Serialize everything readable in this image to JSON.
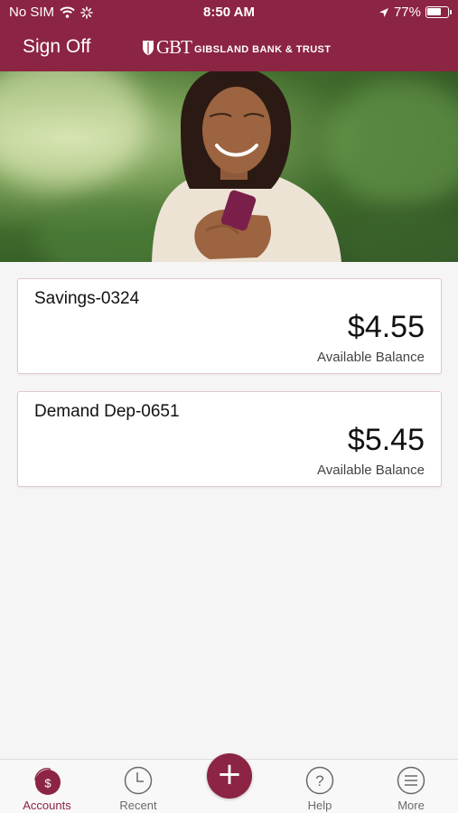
{
  "status_bar": {
    "carrier": "No SIM",
    "time": "8:50 AM",
    "battery": "77%",
    "battery_level": 0.77
  },
  "header": {
    "sign_off_label": "Sign Off",
    "logo_mark": "GBT",
    "logo_name": "GIBSLAND BANK & TRUST"
  },
  "accounts": [
    {
      "name": "Savings-0324",
      "balance": "$4.55",
      "balance_label": "Available Balance"
    },
    {
      "name": "Demand Dep-0651",
      "balance": "$5.45",
      "balance_label": "Available Balance"
    }
  ],
  "tabbar": {
    "tabs": [
      {
        "label": "Accounts",
        "icon": "dollar-circle-icon",
        "active": true
      },
      {
        "label": "Recent",
        "icon": "clock-icon",
        "active": false
      },
      {
        "label": "Help",
        "icon": "question-icon",
        "active": false
      },
      {
        "label": "More",
        "icon": "menu-icon",
        "active": false
      }
    ],
    "fab_icon": "plus-icon"
  },
  "colors": {
    "brand": "#8c2443",
    "background": "#f5f5f5",
    "tab_inactive": "#6a6a6a"
  }
}
